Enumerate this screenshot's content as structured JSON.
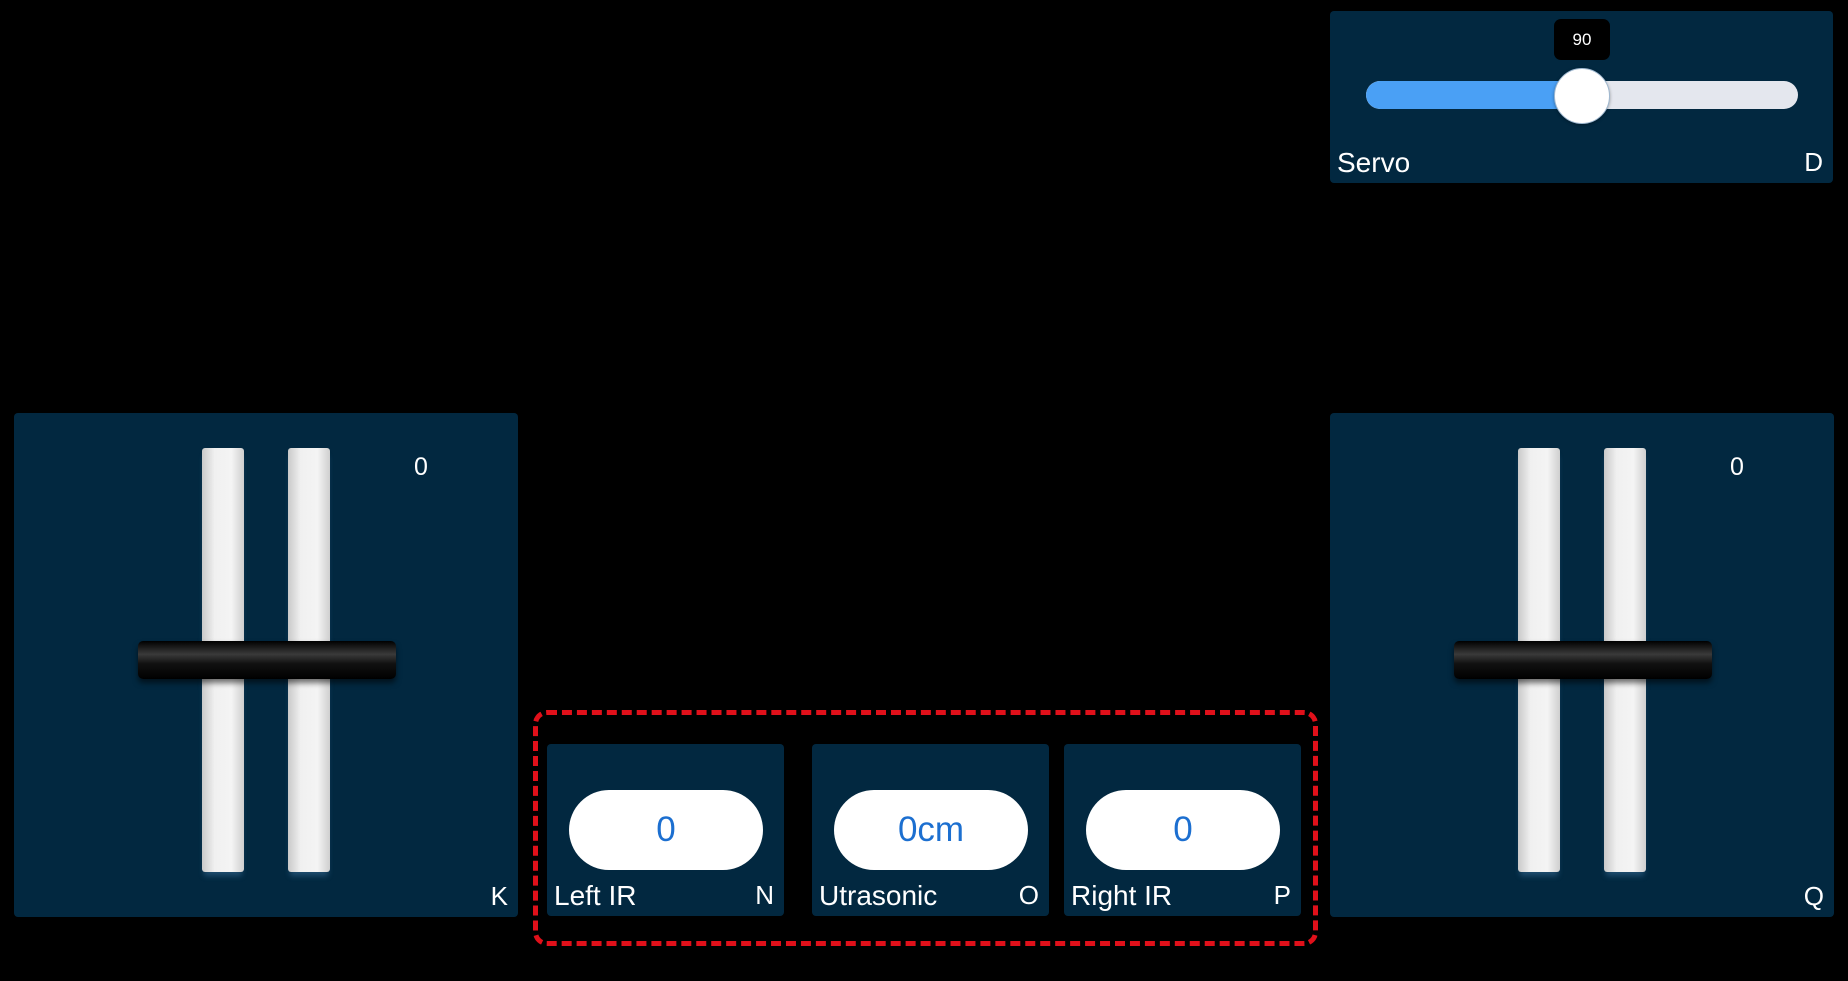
{
  "servo": {
    "value": "90",
    "fraction": 0.5,
    "label": "Servo",
    "key": "D"
  },
  "throttle_left": {
    "value": "0",
    "key": "K"
  },
  "throttle_right": {
    "value": "0",
    "key": "Q"
  },
  "sensors": {
    "left_ir": {
      "value": "0",
      "label": "Left IR",
      "key": "N"
    },
    "ultrasonic": {
      "value": "0cm",
      "label": "Utrasonic",
      "key": "O"
    },
    "right_ir": {
      "value": "0",
      "label": "Right IR",
      "key": "P"
    }
  },
  "colors": {
    "background": "#000000",
    "panel": "#022840",
    "slider_fill": "#4aa0f5",
    "slider_track": "#e4e7ee",
    "sensor_text": "#1c6fd0",
    "highlight_border": "#e0101a"
  }
}
